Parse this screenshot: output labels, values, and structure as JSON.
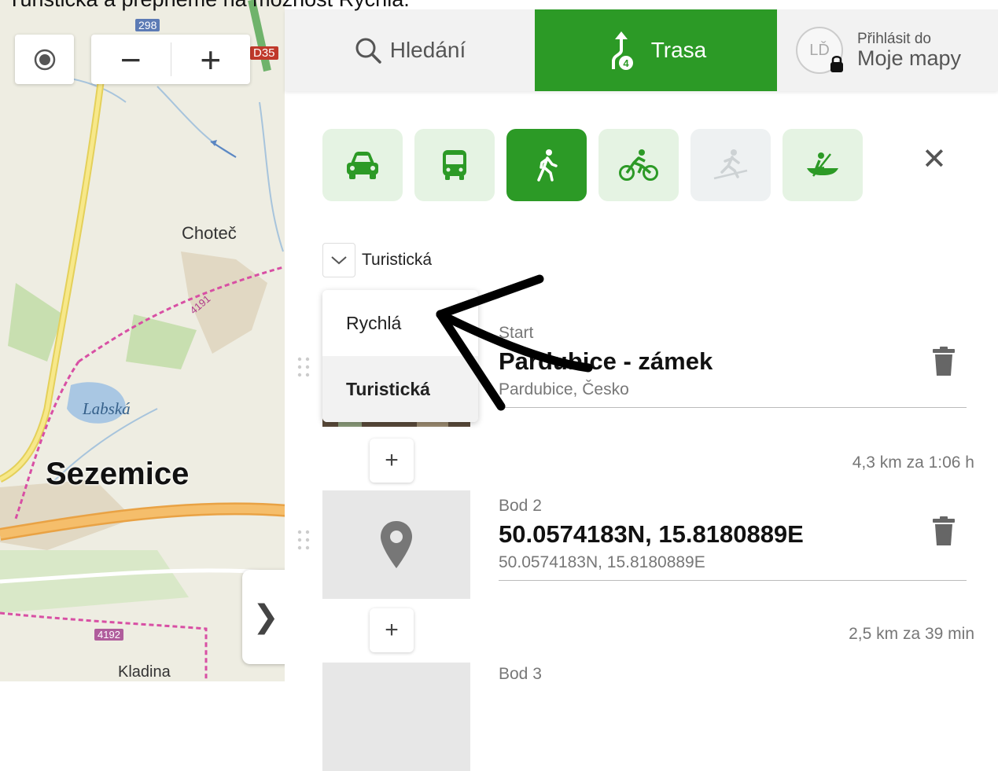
{
  "caption": "Turistická a přepneme na možnost Rychlá.",
  "map": {
    "places": {
      "chotec": "Choteč",
      "labska": "Labská",
      "sezemice": "Sezemice",
      "kladina": "Kladina"
    },
    "road_labels": {
      "r298": "298",
      "d35": "D35",
      "r4191": "4191",
      "r4192": "4192"
    },
    "controls": {
      "zoom_out": "−",
      "zoom_in": "+",
      "collapse": "❯"
    }
  },
  "header": {
    "search_label": "Hledání",
    "route_label": "Trasa",
    "route_badge": "4",
    "avatar_initials": "LĎ",
    "login_line1": "Přihlásit do",
    "login_line2": "Moje mapy"
  },
  "modes": [
    {
      "name": "car",
      "state": "enabled"
    },
    {
      "name": "bus",
      "state": "enabled"
    },
    {
      "name": "walk",
      "state": "active"
    },
    {
      "name": "bike",
      "state": "enabled"
    },
    {
      "name": "ski",
      "state": "disabled"
    },
    {
      "name": "canoe",
      "state": "enabled"
    }
  ],
  "close_label": "✕",
  "route_type": {
    "selected": "Turistická",
    "options": [
      "Rychlá",
      "Turistická"
    ]
  },
  "waypoints": [
    {
      "label": "Start",
      "name": "Pardubice - zámek",
      "detail": "Pardubice, Česko"
    },
    {
      "label": "Bod 2",
      "name": "50.0574183N, 15.8180889E",
      "detail": "50.0574183N, 15.8180889E"
    },
    {
      "label": "Bod 3"
    }
  ],
  "legs": [
    "4,3 km za 1:06 h",
    "2,5 km za 39 min"
  ],
  "add_label": "+",
  "colors": {
    "accent": "#2c9a26",
    "mode_bg": "#e5f3e3"
  }
}
